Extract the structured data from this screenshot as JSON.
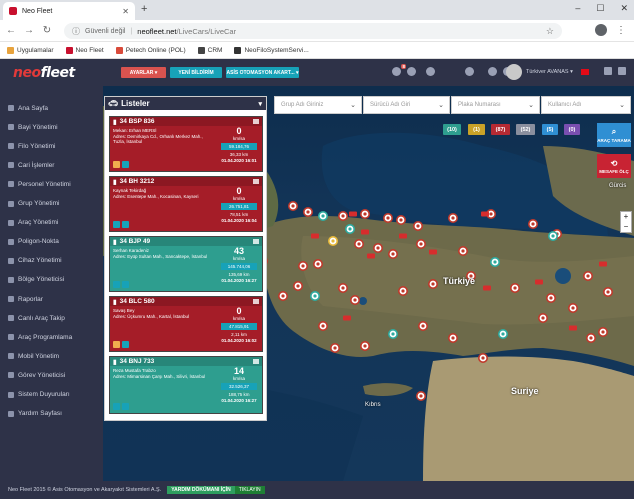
{
  "browser": {
    "tab_title": "Neo Fleet",
    "new_tab": "+",
    "nav_back": "←",
    "nav_forward": "→",
    "nav_reload": "↻",
    "security_text": "Güvenli değil",
    "url_host": "neofleet.net",
    "url_path": "/LiveCars/LiveCar",
    "win_min": "–",
    "win_max": "☐",
    "win_close": "✕"
  },
  "bookmarks": [
    {
      "label": "Uygulamalar",
      "color": "#e8a33d"
    },
    {
      "label": "Neo Fleet",
      "color": "#c8102e"
    },
    {
      "label": "Petech Online (POL)",
      "color": "#d94a3a"
    },
    {
      "label": "CRM",
      "color": "#444444"
    },
    {
      "label": "NeoFiloSystemServi...",
      "color": "#333333"
    }
  ],
  "header": {
    "logo_a": "neo",
    "logo_b": "fleet",
    "btn_settings": "AYARLAR ▾",
    "btn_new": "YENİ BİLDİRİM",
    "btn_company": "ASİS OTOMASYON AKART... ▾",
    "notif_counts": [
      "8",
      "",
      "",
      "",
      "",
      ""
    ],
    "user_name": "Türkiver AVANAS ▾"
  },
  "sidebar": {
    "items": [
      "Ana Sayfa",
      "Bayi Yönetimi",
      "Filo Yönetimi",
      "Cari İşlemler",
      "Personel Yönetimi",
      "Grup Yönetimi",
      "Araç Yönetimi",
      "Poligon-Nokta",
      "Cihaz Yönetimi",
      "Bölge Yöneticisi",
      "Raporlar",
      "Canlı Araç Takip",
      "Araç Programlama",
      "Mobil Yönetim",
      "Görev Yöneticisi",
      "Sistem Duyuruları",
      "Yardım Sayfası"
    ]
  },
  "list": {
    "title": "Listeler",
    "collapse": "▾",
    "cards": [
      {
        "color": "red",
        "plate": "34 BSP 836",
        "driver": "Mekan: Erhan MERSİ",
        "address": "Adres: Demirkaya Cd., Orhanlı Merkez Mah., Tuzla, İstanbul",
        "speed": "0",
        "unit": "km/sa",
        "odometer": "59.184,76",
        "km": "36,33 km",
        "date": "01.04.2020 16:01"
      },
      {
        "color": "red",
        "plate": "34 BH 3212",
        "driver": "Kaynak Tekirdağ",
        "address": "Adres: Esentepe Mah., Kocasinan, Kayseri",
        "speed": "0",
        "unit": "km/sa",
        "odometer": "26.751,81",
        "km": "78,51 km",
        "date": "01.04.2020 16:04"
      },
      {
        "color": "teal",
        "plate": "34 BJP 49",
        "driver": "Serhan Karadeniz",
        "address": "Adres: Eyüp Sultan Mah., Sancaktepe, İstanbul",
        "speed": "43",
        "unit": "km/sa",
        "odometer": "145.744,06",
        "km": "135,69 km",
        "date": "01.04.2020 16:27"
      },
      {
        "color": "red",
        "plate": "34 BLC 580",
        "driver": "Savaş Bey",
        "address": "Adres: Üçkumru Mah., Kartal, İstanbul",
        "speed": "0",
        "unit": "km/sa",
        "odometer": "47.815,91",
        "km": "2,11 km",
        "date": "01.04.2020 16:02"
      },
      {
        "color": "teal",
        "plate": "34 BNJ 733",
        "driver": "Reza Mustafa Trabzo",
        "address": "Adres: Mimarsinan Çarşı Mah., Silivri, İstanbul",
        "speed": "14",
        "unit": "km/sa",
        "odometer": "32.526,37",
        "km": "188,75 km",
        "date": "01.04.2020 16:27"
      }
    ]
  },
  "filters": {
    "group": "Grup Adı Giriniz",
    "driver": "Sürücü Adı Giri",
    "plate": "Plaka Numarası",
    "user": "Kullanıcı Adı"
  },
  "status_pills": [
    {
      "label": "(10)",
      "color": "#2e9e8f"
    },
    {
      "label": "(1)",
      "color": "#c9a227"
    },
    {
      "label": "(87)",
      "color": "#b52a33"
    },
    {
      "label": "(52)",
      "color": "#8a8f9e"
    },
    {
      "label": "(5)",
      "color": "#2f8fd3"
    },
    {
      "label": "(0)",
      "color": "#7a4fb0"
    }
  ],
  "map_buttons": {
    "search": "ARAÇ TARAMA",
    "distance": "MESAFE ÖLÇ"
  },
  "map": {
    "zoom_in": "+",
    "zoom_out": "−",
    "labels": {
      "country": "Türkiye",
      "syria": "Suriye",
      "gurcis": "Gürcis",
      "cyprus": "Kıbrıs"
    }
  },
  "footer": {
    "copyright": "Neo Fleet 2015 © Asis Otomasyon ve Akaryakıt Sistemleri A.Ş.",
    "help_btn": "YARDIM DÖKÜMANI İÇİN",
    "help_link": "TIKLAYIN"
  }
}
